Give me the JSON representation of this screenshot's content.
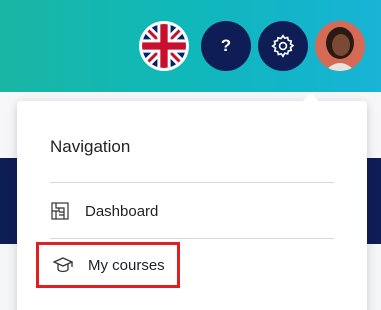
{
  "header": {
    "language_flag": "uk-flag-icon",
    "help_label": "?",
    "settings_icon": "gear-icon",
    "avatar_icon": "user-avatar"
  },
  "dropdown": {
    "title": "Navigation",
    "items": [
      {
        "label": "Dashboard",
        "icon": "dashboard-icon"
      },
      {
        "label": "My courses",
        "icon": "graduation-cap-icon",
        "highlighted": true
      }
    ]
  },
  "colors": {
    "header_gradient_start": "#1ab6a4",
    "header_gradient_end": "#19b4d6",
    "button_navy": "#0f1d56",
    "highlight_border": "#e02020"
  }
}
